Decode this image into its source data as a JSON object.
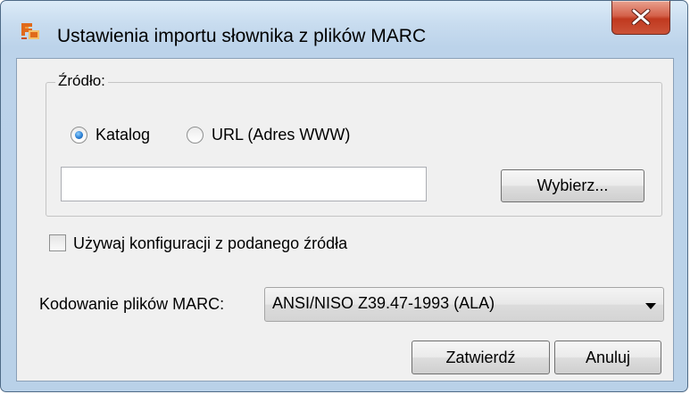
{
  "window": {
    "title": "Ustawienia importu słownika z plików MARC",
    "close_icon": "close-icon",
    "app_icon": "app-logo-icon"
  },
  "source_group": {
    "legend": "Źródło:",
    "options": [
      {
        "label": "Katalog",
        "checked": true
      },
      {
        "label": "URL (Adres WWW)",
        "checked": false
      }
    ],
    "path_value": "",
    "browse_label": "Wybierz..."
  },
  "use_config": {
    "label": "Używaj konfiguracji z podanego źródła",
    "checked": false
  },
  "encoding": {
    "label": "Kodowanie plików MARC:",
    "selected": "ANSI/NISO Z39.47-1993 (ALA)"
  },
  "buttons": {
    "confirm_label": "Zatwierdź",
    "cancel_label": "Anuluj"
  }
}
